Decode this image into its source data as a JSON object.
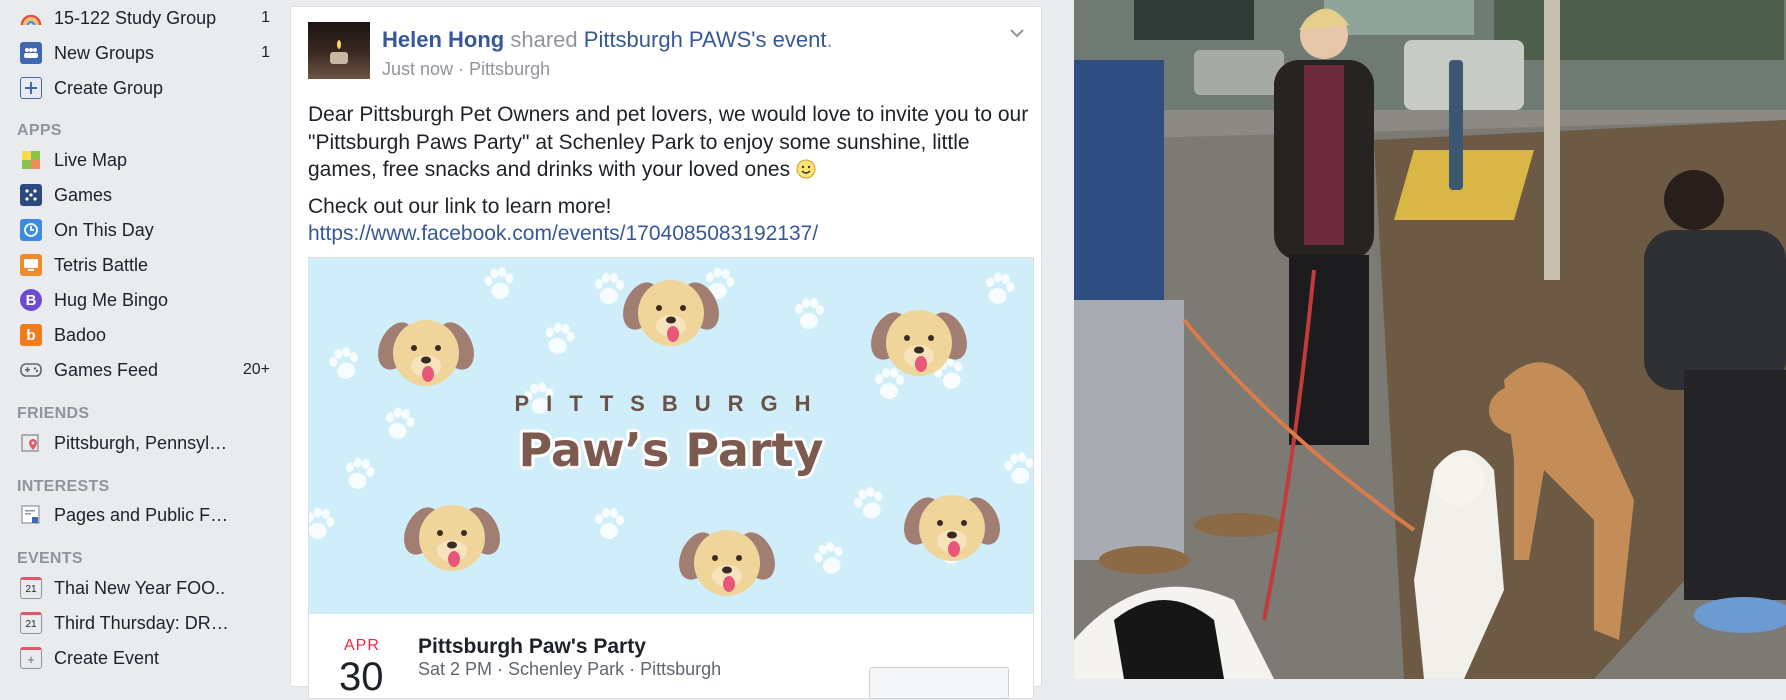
{
  "sidebar": {
    "groups": [
      {
        "label": "15-122 Study Group",
        "count": "1",
        "icon": "rainbow-icon"
      },
      {
        "label": "New Groups",
        "count": "1",
        "icon": "groups-icon"
      },
      {
        "label": "Create Group",
        "count": "",
        "icon": "plus-icon"
      }
    ],
    "sections": {
      "apps": "APPS",
      "friends": "FRIENDS",
      "interests": "INTERESTS",
      "events": "EVENTS"
    },
    "apps": [
      {
        "label": "Live Map",
        "count": "",
        "icon": "map-icon"
      },
      {
        "label": "Games",
        "count": "",
        "icon": "games-icon"
      },
      {
        "label": "On This Day",
        "count": "",
        "icon": "clock-icon"
      },
      {
        "label": "Tetris Battle",
        "count": "",
        "icon": "tetris-icon"
      },
      {
        "label": "Hug Me Bingo",
        "count": "",
        "icon": "bingo-icon"
      },
      {
        "label": "Badoo",
        "count": "",
        "icon": "badoo-icon"
      },
      {
        "label": "Games Feed",
        "count": "20+",
        "icon": "gamepad-icon"
      }
    ],
    "friends": [
      {
        "label": "Pittsburgh, Pennsyl…",
        "icon": "location-pin-icon"
      }
    ],
    "interests": [
      {
        "label": "Pages and Public F…",
        "icon": "pages-feed-icon"
      }
    ],
    "events": [
      {
        "label": "Thai New Year FOO..",
        "icon": "calendar-icon",
        "day": "21"
      },
      {
        "label": "Third Thursday: DR…",
        "icon": "calendar-icon",
        "day": "21"
      },
      {
        "label": "Create Event",
        "icon": "calendar-plus-icon",
        "day": "+"
      }
    ]
  },
  "post": {
    "author": "Helen Hong",
    "verb": "shared",
    "page": "Pittsburgh PAWS",
    "possessive": "'s",
    "object": "event",
    "period": ".",
    "time": "Just now",
    "separator": " · ",
    "location": "Pittsburgh",
    "body": "Dear Pittsburgh Pet Owners and pet lovers, we would love to invite you to our \"Pittsburgh Paws Party\" at Schenley Park to enjoy some sunshine, little games, free snacks and drinks with your loved ones",
    "body2": "Check out our link to learn more!",
    "link": "https://www.facebook.com/events/1704085083192137/"
  },
  "event": {
    "banner_line1": "PITTSBURGH",
    "banner_line2": "Paw’s Party",
    "month": "APR",
    "day": "30",
    "title": "Pittsburgh Paw's Party",
    "details": "Sat 2 PM · Schenley Park · Pittsburgh"
  },
  "colors": {
    "link": "#365899",
    "banner_bg": "#cfeef9",
    "month_red": "#f02849"
  }
}
